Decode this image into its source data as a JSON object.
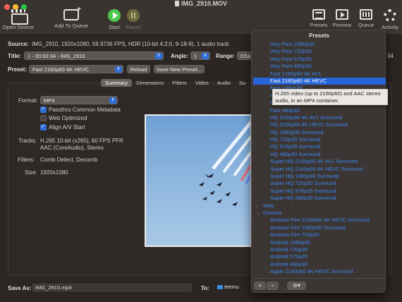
{
  "window": {
    "title": "IMG_2910.MOV"
  },
  "toolbar": {
    "open_source": "Open Source",
    "add_to_queue": "Add To Queue",
    "start": "Start",
    "pause": "Pause",
    "presets": "Presets",
    "preview": "Preview",
    "queue": "Queue",
    "activity": "Activity"
  },
  "source": {
    "label": "Source:",
    "value": "IMG_2910, 1920x1080, 59.9736 FPS, HDR (10-bit 4:2:0, 9-18-9), 1 audio track"
  },
  "title_row": {
    "title_label": "Title:",
    "title_value": "1 - 00:00:34 - IMG_2910",
    "angle_label": "Angle:",
    "angle_value": "1",
    "range_label": "Range:",
    "range_value": "Cha",
    "duration_tail": "34"
  },
  "preset_row": {
    "label": "Preset:",
    "value": "Fast 2160p60 4K HEVC",
    "reload": "Reload",
    "save_new": "Save New Preset..."
  },
  "tabs": [
    "Summary",
    "Dimensions",
    "Filters",
    "Video",
    "Audio",
    "Su"
  ],
  "summary": {
    "format_label": "Format:",
    "format_value": "MP4",
    "passthru": "Passthru Common Metadata",
    "web_optimized": "Web Optimized",
    "align_av": "Align A/V Start",
    "tracks_label": "Tracks:",
    "tracks_line1": "H.265 10-bit (x265), 60 FPS PFR",
    "tracks_line2": "AAC (CoreAudio), Stereo",
    "filters_label": "Filters:",
    "filters_value": "Comb Detect, Decomb",
    "size_label": "Size:",
    "size_value": "1920x1080"
  },
  "save": {
    "label": "Save As:",
    "value": "IMG_2910.mp4",
    "to_label": "To:",
    "to_value": "teemu"
  },
  "presets_panel": {
    "title": "Presets",
    "items": [
      {
        "label": "Very Fast 1080p30",
        "kind": "item"
      },
      {
        "label": "Very Fast 720p30",
        "kind": "item"
      },
      {
        "label": "Very Fast 576p25",
        "kind": "item"
      },
      {
        "label": "Very Fast 480p30",
        "kind": "item"
      },
      {
        "label": "Fast 2160p60 4K AV1",
        "kind": "item"
      },
      {
        "label": "Fast 2160p60 4K HEVC",
        "kind": "selected"
      },
      {
        "label": "Fast 1080p30",
        "kind": "item"
      },
      {
        "label": "Fast 720p30",
        "kind": "item"
      },
      {
        "label": "Fast 576p25",
        "kind": "item"
      },
      {
        "label": "Fast 480p30",
        "kind": "item"
      },
      {
        "label": "HQ 2160p60 4K AV1 Surround",
        "kind": "item"
      },
      {
        "label": "HQ 2160p60 4K HEVC Surround",
        "kind": "item"
      },
      {
        "label": "HQ 1080p30 Surround",
        "kind": "item"
      },
      {
        "label": "HQ 720p30 Surround",
        "kind": "item"
      },
      {
        "label": "HQ 576p25 Surround",
        "kind": "item"
      },
      {
        "label": "HQ 480p30 Surround",
        "kind": "item"
      },
      {
        "label": "Super HQ 2160p60 4K AV1 Surround",
        "kind": "item"
      },
      {
        "label": "Super HQ 2160p60 4K HEVC Surround",
        "kind": "item"
      },
      {
        "label": "Super HQ 1080p30 Surround",
        "kind": "item"
      },
      {
        "label": "Super HQ 720p30 Surround",
        "kind": "item"
      },
      {
        "label": "Super HQ 576p25 Surround",
        "kind": "item"
      },
      {
        "label": "Super HQ 480p30 Surround",
        "kind": "item"
      },
      {
        "label": "Web",
        "kind": "group-collapsed"
      },
      {
        "label": "Devices",
        "kind": "group-expanded"
      },
      {
        "label": "Amazon Fire 2160p60 4K HEVC Surround",
        "kind": "item"
      },
      {
        "label": "Amazon Fire 1080p30 Surround",
        "kind": "item"
      },
      {
        "label": "Amazon Fire 720p30",
        "kind": "item"
      },
      {
        "label": "Android 1080p30",
        "kind": "item"
      },
      {
        "label": "Android 720p30",
        "kind": "item"
      },
      {
        "label": "Android 576p25",
        "kind": "item"
      },
      {
        "label": "Android 480p30",
        "kind": "item"
      },
      {
        "label": "Apple 2160p60 4K HEVC Surround",
        "kind": "item"
      }
    ],
    "tooltip": "H.265 video (up to 2160p60) and AAC stereo audio, in an MP4 container.",
    "add": "+",
    "remove": "−"
  },
  "colors": {
    "accent": "#2f6fd6",
    "link": "#3d86f0",
    "bg": "#2b2623"
  }
}
